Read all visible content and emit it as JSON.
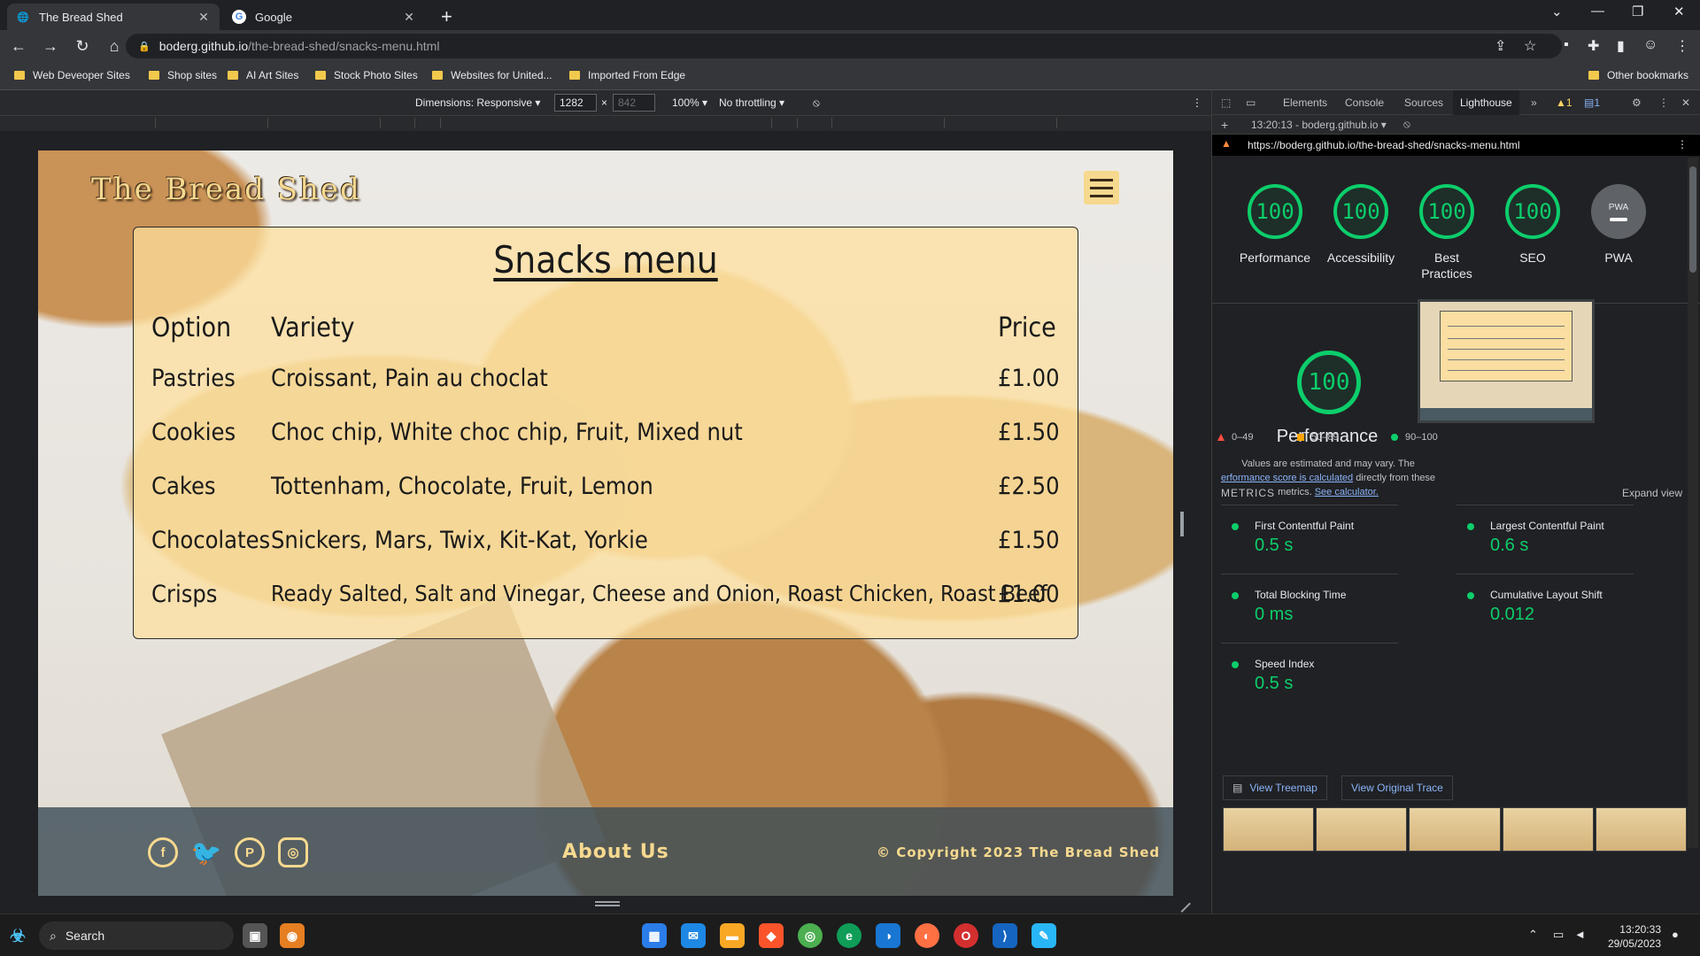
{
  "tabs": [
    {
      "title": "The Bread Shed",
      "active": true
    },
    {
      "title": "Google",
      "active": false
    }
  ],
  "window_controls": {
    "minimize": "—",
    "maximize": "❐",
    "close": "✕",
    "dropdown": "⌄"
  },
  "address": {
    "host": "boderg.github.io",
    "path": "/the-bread-shed/snacks-menu.html"
  },
  "bookmarks": [
    "Web Deveoper Sites",
    "Shop sites",
    "AI Art Sites",
    "Stock Photo Sites",
    "Websites for United...",
    "Imported From Edge",
    "Other bookmarks"
  ],
  "device_toolbar": {
    "dimensions": "Dimensions: Responsive ▾",
    "width": "1282",
    "times": "×",
    "height_placeholder": "842",
    "zoom": "100% ▾",
    "throttling": "No throttling ▾"
  },
  "site": {
    "logo": "The Bread Shed",
    "menu": {
      "title": "Snacks menu",
      "headers": {
        "option": "Option",
        "variety": "Variety",
        "price": "Price"
      },
      "rows": [
        {
          "option": "Pastries",
          "variety": "Croissant, Pain au choclat",
          "price": "£1.00"
        },
        {
          "option": "Cookies",
          "variety": "Choc chip, White choc chip, Fruit, Mixed nut",
          "price": "£1.50"
        },
        {
          "option": "Cakes",
          "variety": "Tottenham, Chocolate, Fruit, Lemon",
          "price": "£2.50"
        },
        {
          "option": "Chocolates",
          "variety": "Snickers, Mars, Twix, Kit-Kat, Yorkie",
          "price": "£1.50"
        },
        {
          "option": "Crisps",
          "variety": "Ready Salted, Salt and Vinegar, Cheese and Onion, Roast Chicken, Roast Beef",
          "price": "£1.00"
        }
      ]
    },
    "footer": {
      "social": [
        "facebook-icon",
        "twitter-icon",
        "pinterest-icon",
        "instagram-icon"
      ],
      "about": "About Us",
      "copyright": "© Copyright 2023 The Bread Shed"
    }
  },
  "devtools": {
    "tabs": [
      "Elements",
      "Console",
      "Sources",
      "Lighthouse"
    ],
    "active_tab": "Lighthouse",
    "warnings": "1",
    "messages": "1",
    "report_time": "13:20:13 - boderg.github.io ▾",
    "lighthouse_url": "https://boderg.github.io/the-bread-shed/snacks-menu.html",
    "scores": [
      {
        "label": "Performance",
        "value": "100"
      },
      {
        "label": "Accessibility",
        "value": "100"
      },
      {
        "label": "Best Practices",
        "value": "100"
      },
      {
        "label": "SEO",
        "value": "100"
      }
    ],
    "pwa": {
      "label": "PWA",
      "badge": "PWA"
    },
    "performance": {
      "score": "100",
      "title": "Performance",
      "desc_1": "Values are estimated and may vary. The",
      "desc_link": "erformance score is calculated",
      "desc_2": "directly from these",
      "desc_3": "metrics.",
      "calc_link": "See calculator."
    },
    "legend": [
      {
        "range": "0–49",
        "color": "#ff4e42"
      },
      {
        "range": "50–89",
        "color": "#ffa400"
      },
      {
        "range": "90–100",
        "color": "#0cce6b"
      }
    ],
    "metrics_heading": "METRICS",
    "expand": "Expand view",
    "metrics": [
      {
        "name": "First Contentful Paint",
        "value": "0.5 s"
      },
      {
        "name": "Largest Contentful Paint",
        "value": "0.6 s"
      },
      {
        "name": "Total Blocking Time",
        "value": "0 ms"
      },
      {
        "name": "Cumulative Layout Shift",
        "value": "0.012"
      },
      {
        "name": "Speed Index",
        "value": "0.5 s"
      }
    ],
    "buttons": {
      "treemap": "View Treemap",
      "trace": "View Original Trace"
    }
  },
  "taskbar": {
    "search": "Search",
    "time": "13:20:33",
    "date": "29/05/2023"
  }
}
